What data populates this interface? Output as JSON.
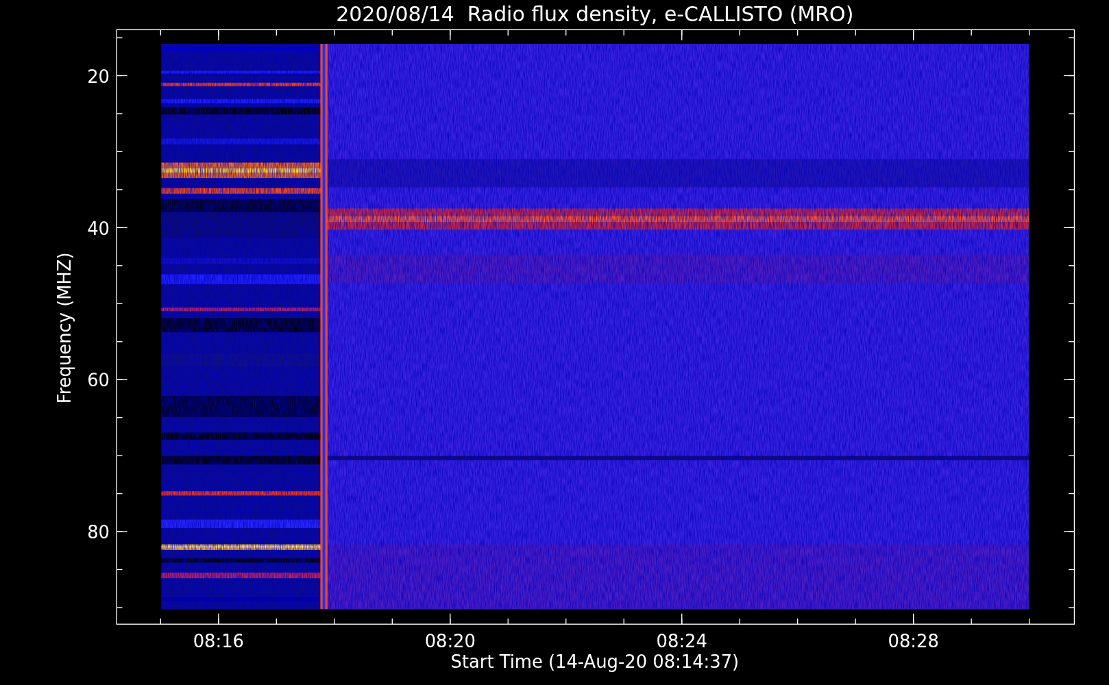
{
  "title": "2020/08/14  Radio flux density, e-CALLISTO (MRO)",
  "plot": {
    "ylabel": "Frequency (MHZ)",
    "xlabel": "Start Time (14-Aug-20 08:14:37)",
    "yticks": [
      "20",
      "40",
      "60",
      "80"
    ],
    "xticks": [
      "08:16",
      "08:20",
      "08:24",
      "08:28"
    ]
  }
}
